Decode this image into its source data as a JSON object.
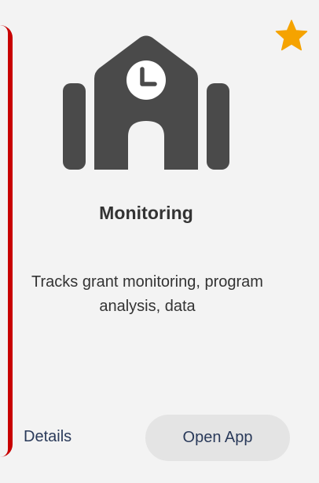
{
  "card": {
    "title": "Monitoring",
    "description": "Tracks grant monitoring, program analysis, data",
    "details_label": "Details",
    "open_app_label": "Open App",
    "favorited": true,
    "icon": "school-building-clock-icon"
  },
  "colors": {
    "accent_border": "#c80000",
    "star": "#f5a300",
    "icon": "#4a4a4a",
    "text": "#333333",
    "link": "#2a3a5a",
    "button_bg": "#e4e4e4",
    "background": "#f3f3f3"
  }
}
